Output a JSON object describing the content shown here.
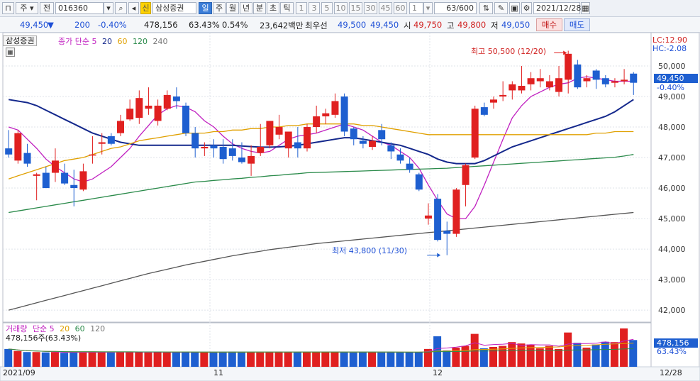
{
  "toolbar": {
    "chart_type_icon": "chart-icon",
    "period_label": "주",
    "mode_label": "전",
    "stock_code": "016360",
    "stock_name": "삼성증권",
    "credit_badge": "신",
    "intervals": [
      "일",
      "주",
      "월",
      "년",
      "분",
      "초",
      "틱"
    ],
    "active_interval": "일",
    "minute_values": [
      "1",
      "3",
      "5",
      "10",
      "15",
      "30",
      "45",
      "60"
    ],
    "custom_value": "1",
    "bar_count": "63/600",
    "date": "2021/12/28"
  },
  "quote": {
    "price": "49,450",
    "change": "200",
    "change_pct": "-0.40%",
    "volume": "478,156",
    "turnover_pct": "63.43%",
    "other_pct": "0.54%",
    "amount": "23,642백만",
    "bid_label": "최우선",
    "bid1": "49,500",
    "bid2": "49,450",
    "open_label": "시",
    "open": "49,750",
    "high_label": "고",
    "high": "49,800",
    "low_label": "저",
    "low": "49,050",
    "buy_label": "매수",
    "sell_label": "매도"
  },
  "price_panel": {
    "stock_tag": "삼성증권",
    "ma_title": "종가 단순",
    "ma_periods": [
      "5",
      "20",
      "60",
      "120",
      "240"
    ],
    "lc_label": "LC:12.90",
    "hc_label": "HC:-2.08",
    "current_price_label": "49,450",
    "current_change_label": "-0.40%",
    "high_annotation": "최고 50,500 (12/20)",
    "low_annotation": "최저 43,800 (11/30)"
  },
  "volume_panel": {
    "title_prefix": "거래량",
    "ma_title": "단순",
    "ma_periods": [
      "5",
      "20",
      "60",
      "120"
    ],
    "summary": "478,156주(63.43%)",
    "current_volume_label": "478,156",
    "current_pct_label": "63.43%"
  },
  "time_axis": {
    "left_label": "2021/09",
    "mid_labels": [
      "11",
      "12"
    ],
    "right_label": "12/28"
  },
  "colors": {
    "up": "#e02020",
    "down": "#1e5fd0",
    "ma5": "#c020c0",
    "ma20": "#14288c",
    "ma60": "#e0a000",
    "ma120": "#2a8a4a",
    "ma240": "#555555"
  },
  "chart_data": {
    "type": "candlestick",
    "ylim": [
      41700,
      51000
    ],
    "yticks": [
      42000,
      43000,
      44000,
      45000,
      46000,
      47000,
      48000,
      49000,
      50000
    ],
    "ytick_labels": [
      "42,000",
      "43,000",
      "44,000",
      "45,000",
      "46,000",
      "47,000",
      "48,000",
      "49,000",
      "50,000"
    ],
    "candles": [
      {
        "o": 47300,
        "h": 47900,
        "l": 47000,
        "c": 47100
      },
      {
        "o": 46900,
        "h": 47900,
        "l": 46800,
        "c": 47800
      },
      {
        "o": 47150,
        "h": 47450,
        "l": 46700,
        "c": 46800
      },
      {
        "o": 46400,
        "h": 46500,
        "l": 45600,
        "c": 46450
      },
      {
        "o": 46500,
        "h": 46700,
        "l": 46000,
        "c": 46000
      },
      {
        "o": 46500,
        "h": 47300,
        "l": 46200,
        "c": 46900
      },
      {
        "o": 46500,
        "h": 46800,
        "l": 46100,
        "c": 46150
      },
      {
        "o": 46100,
        "h": 46600,
        "l": 45400,
        "c": 46000
      },
      {
        "o": 45950,
        "h": 46800,
        "l": 45900,
        "c": 46550
      },
      {
        "o": 47100,
        "h": 47700,
        "l": 46800,
        "c": 47100
      },
      {
        "o": 47450,
        "h": 47800,
        "l": 47100,
        "c": 47500
      },
      {
        "o": 47700,
        "h": 47800,
        "l": 47400,
        "c": 47450
      },
      {
        "o": 47800,
        "h": 48400,
        "l": 47700,
        "c": 48200
      },
      {
        "o": 48250,
        "h": 48900,
        "l": 48200,
        "c": 48600
      },
      {
        "o": 48300,
        "h": 49200,
        "l": 48100,
        "c": 48950
      },
      {
        "o": 48600,
        "h": 49300,
        "l": 48400,
        "c": 48700
      },
      {
        "o": 48200,
        "h": 48900,
        "l": 48050,
        "c": 48700
      },
      {
        "o": 48600,
        "h": 49200,
        "l": 48550,
        "c": 49050
      },
      {
        "o": 49000,
        "h": 49300,
        "l": 48600,
        "c": 48850
      },
      {
        "o": 48700,
        "h": 48800,
        "l": 47700,
        "c": 47800
      },
      {
        "o": 47800,
        "h": 48000,
        "l": 47000,
        "c": 47300
      },
      {
        "o": 47300,
        "h": 47500,
        "l": 47050,
        "c": 47350
      },
      {
        "o": 47400,
        "h": 47600,
        "l": 47000,
        "c": 47300
      },
      {
        "o": 47350,
        "h": 47600,
        "l": 46800,
        "c": 46950
      },
      {
        "o": 47300,
        "h": 47600,
        "l": 46900,
        "c": 47050
      },
      {
        "o": 47000,
        "h": 47500,
        "l": 46800,
        "c": 46850
      },
      {
        "o": 46800,
        "h": 47400,
        "l": 46400,
        "c": 47050
      },
      {
        "o": 47150,
        "h": 48100,
        "l": 47050,
        "c": 47350
      },
      {
        "o": 47400,
        "h": 48200,
        "l": 47300,
        "c": 48200
      },
      {
        "o": 47750,
        "h": 48400,
        "l": 47600,
        "c": 48000
      },
      {
        "o": 47300,
        "h": 47800,
        "l": 47000,
        "c": 47850
      },
      {
        "o": 47500,
        "h": 48000,
        "l": 47000,
        "c": 47300
      },
      {
        "o": 47300,
        "h": 48100,
        "l": 47200,
        "c": 48000
      },
      {
        "o": 48000,
        "h": 48700,
        "l": 47800,
        "c": 48350
      },
      {
        "o": 48350,
        "h": 48600,
        "l": 48100,
        "c": 48450
      },
      {
        "o": 48400,
        "h": 49100,
        "l": 48300,
        "c": 48850
      },
      {
        "o": 49000,
        "h": 49100,
        "l": 47700,
        "c": 47850
      },
      {
        "o": 47950,
        "h": 48000,
        "l": 47400,
        "c": 47600
      },
      {
        "o": 47550,
        "h": 47700,
        "l": 47300,
        "c": 47450
      },
      {
        "o": 47350,
        "h": 47700,
        "l": 47250,
        "c": 47550
      },
      {
        "o": 47900,
        "h": 48100,
        "l": 47400,
        "c": 47600
      },
      {
        "o": 47400,
        "h": 47500,
        "l": 46950,
        "c": 47200
      },
      {
        "o": 47100,
        "h": 47300,
        "l": 46800,
        "c": 46900
      },
      {
        "o": 46800,
        "h": 47000,
        "l": 46500,
        "c": 46600
      },
      {
        "o": 46450,
        "h": 46500,
        "l": 45900,
        "c": 45950
      },
      {
        "o": 45000,
        "h": 45500,
        "l": 44800,
        "c": 45100
      },
      {
        "o": 45650,
        "h": 45800,
        "l": 44250,
        "c": 44300
      },
      {
        "o": 44600,
        "h": 44900,
        "l": 43800,
        "c": 44500
      },
      {
        "o": 44500,
        "h": 46000,
        "l": 44400,
        "c": 45950
      },
      {
        "o": 46100,
        "h": 46800,
        "l": 45400,
        "c": 46750
      },
      {
        "o": 47000,
        "h": 48700,
        "l": 46950,
        "c": 48600
      },
      {
        "o": 48650,
        "h": 48800,
        "l": 48350,
        "c": 48400
      },
      {
        "o": 48800,
        "h": 49000,
        "l": 48600,
        "c": 48900
      },
      {
        "o": 49000,
        "h": 49500,
        "l": 48850,
        "c": 49050
      },
      {
        "o": 49200,
        "h": 49500,
        "l": 48900,
        "c": 49400
      },
      {
        "o": 49200,
        "h": 50000,
        "l": 49100,
        "c": 49350
      },
      {
        "o": 49400,
        "h": 49800,
        "l": 49200,
        "c": 49600
      },
      {
        "o": 49500,
        "h": 49900,
        "l": 49300,
        "c": 49600
      },
      {
        "o": 49300,
        "h": 49700,
        "l": 49200,
        "c": 49500
      },
      {
        "o": 49150,
        "h": 50000,
        "l": 49000,
        "c": 49600
      },
      {
        "o": 49550,
        "h": 50500,
        "l": 49100,
        "c": 50400
      },
      {
        "o": 50050,
        "h": 50200,
        "l": 49250,
        "c": 49300
      },
      {
        "o": 49500,
        "h": 49700,
        "l": 49300,
        "c": 49600
      },
      {
        "o": 49850,
        "h": 49900,
        "l": 49250,
        "c": 49550
      },
      {
        "o": 49600,
        "h": 49700,
        "l": 49300,
        "c": 49400
      },
      {
        "o": 49450,
        "h": 49600,
        "l": 49300,
        "c": 49500
      },
      {
        "o": 49500,
        "h": 49900,
        "l": 49400,
        "c": 49550
      },
      {
        "o": 49750,
        "h": 49800,
        "l": 49050,
        "c": 49450
      }
    ],
    "ma_series": [
      {
        "name": "5",
        "key": "ma5",
        "values": [
          48000,
          47900,
          47600,
          47300,
          46950,
          46700,
          46500,
          46300,
          46200,
          46300,
          46500,
          46700,
          47000,
          47300,
          47700,
          48050,
          48400,
          48600,
          48700,
          48650,
          48500,
          48200,
          48000,
          47700,
          47450,
          47300,
          47200,
          47150,
          47200,
          47400,
          47600,
          47700,
          47750,
          47800,
          47900,
          48000,
          48100,
          48000,
          47900,
          47700,
          47500,
          47400,
          47200,
          47000,
          46650,
          46100,
          45600,
          45150,
          45000,
          45000,
          45400,
          46100,
          46850,
          47600,
          48300,
          48700,
          49000,
          49150,
          49300,
          49400,
          49450,
          49600,
          49650,
          49600,
          49550,
          49500,
          49500,
          49500
        ]
      },
      {
        "name": "20",
        "key": "ma20",
        "values": [
          48900,
          48850,
          48800,
          48700,
          48550,
          48400,
          48250,
          48100,
          47950,
          47800,
          47700,
          47600,
          47500,
          47450,
          47400,
          47400,
          47400,
          47400,
          47400,
          47400,
          47400,
          47400,
          47400,
          47400,
          47400,
          47380,
          47360,
          47340,
          47340,
          47350,
          47370,
          47400,
          47450,
          47500,
          47550,
          47600,
          47650,
          47650,
          47600,
          47550,
          47500,
          47450,
          47400,
          47300,
          47200,
          47100,
          46950,
          46850,
          46800,
          46800,
          46800,
          46900,
          47050,
          47200,
          47350,
          47450,
          47550,
          47650,
          47750,
          47850,
          47950,
          48050,
          48150,
          48250,
          48350,
          48500,
          48700,
          48900
        ]
      },
      {
        "name": "60",
        "key": "ma60",
        "values": [
          46300,
          46400,
          46500,
          46600,
          46700,
          46800,
          46900,
          46950,
          47000,
          47100,
          47200,
          47300,
          47350,
          47450,
          47550,
          47600,
          47650,
          47700,
          47750,
          47800,
          47800,
          47800,
          47850,
          47850,
          47900,
          47900,
          47950,
          47950,
          48000,
          48000,
          48050,
          48050,
          48100,
          48100,
          48100,
          48100,
          48100,
          48100,
          48050,
          48050,
          48000,
          47950,
          47900,
          47850,
          47800,
          47750,
          47750,
          47750,
          47750,
          47750,
          47750,
          47750,
          47750,
          47750,
          47750,
          47750,
          47750,
          47750,
          47750,
          47750,
          47750,
          47750,
          47750,
          47800,
          47800,
          47850,
          47850,
          47850
        ]
      },
      {
        "name": "120",
        "key": "ma120",
        "values": [
          45200,
          45250,
          45300,
          45350,
          45400,
          45450,
          45500,
          45550,
          45600,
          45650,
          45700,
          45750,
          45800,
          45850,
          45900,
          45950,
          46000,
          46050,
          46100,
          46150,
          46200,
          46220,
          46250,
          46270,
          46300,
          46320,
          46350,
          46370,
          46400,
          46420,
          46450,
          46470,
          46500,
          46510,
          46520,
          46530,
          46540,
          46550,
          46560,
          46570,
          46580,
          46590,
          46600,
          46610,
          46620,
          46630,
          46640,
          46650,
          46670,
          46690,
          46710,
          46730,
          46750,
          46770,
          46790,
          46810,
          46830,
          46850,
          46870,
          46890,
          46910,
          46930,
          46950,
          46970,
          46990,
          47010,
          47050,
          47100
        ]
      },
      {
        "name": "240",
        "key": "ma240",
        "values": [
          42000,
          42080,
          42160,
          42240,
          42320,
          42400,
          42480,
          42560,
          42640,
          42720,
          42800,
          42880,
          42960,
          43040,
          43120,
          43200,
          43270,
          43340,
          43410,
          43480,
          43540,
          43600,
          43660,
          43720,
          43780,
          43830,
          43880,
          43930,
          43980,
          44020,
          44060,
          44100,
          44140,
          44180,
          44210,
          44240,
          44270,
          44300,
          44330,
          44360,
          44390,
          44420,
          44450,
          44480,
          44510,
          44540,
          44570,
          44600,
          44630,
          44660,
          44690,
          44720,
          44750,
          44780,
          44810,
          44840,
          44870,
          44900,
          44930,
          44960,
          44990,
          45020,
          45050,
          45080,
          45110,
          45140,
          45170,
          45200
        ]
      }
    ],
    "volume": {
      "ylim": [
        0,
        1200000
      ],
      "values": [
        520000,
        460000,
        430000,
        430000,
        420000,
        430000,
        410000,
        430000,
        420000,
        430000,
        430000,
        420000,
        440000,
        430000,
        430000,
        420000,
        430000,
        420000,
        420000,
        440000,
        420000,
        430000,
        420000,
        430000,
        440000,
        430000,
        430000,
        420000,
        430000,
        440000,
        430000,
        440000,
        430000,
        430000,
        440000,
        430000,
        430000,
        420000,
        440000,
        430000,
        420000,
        430000,
        420000,
        420000,
        430000,
        520000,
        890000,
        480000,
        560000,
        610000,
        960000,
        540000,
        580000,
        610000,
        720000,
        680000,
        650000,
        540000,
        610000,
        520000,
        1000000,
        700000,
        560000,
        650000,
        730000,
        720000,
        1120000,
        780000
      ]
    }
  }
}
